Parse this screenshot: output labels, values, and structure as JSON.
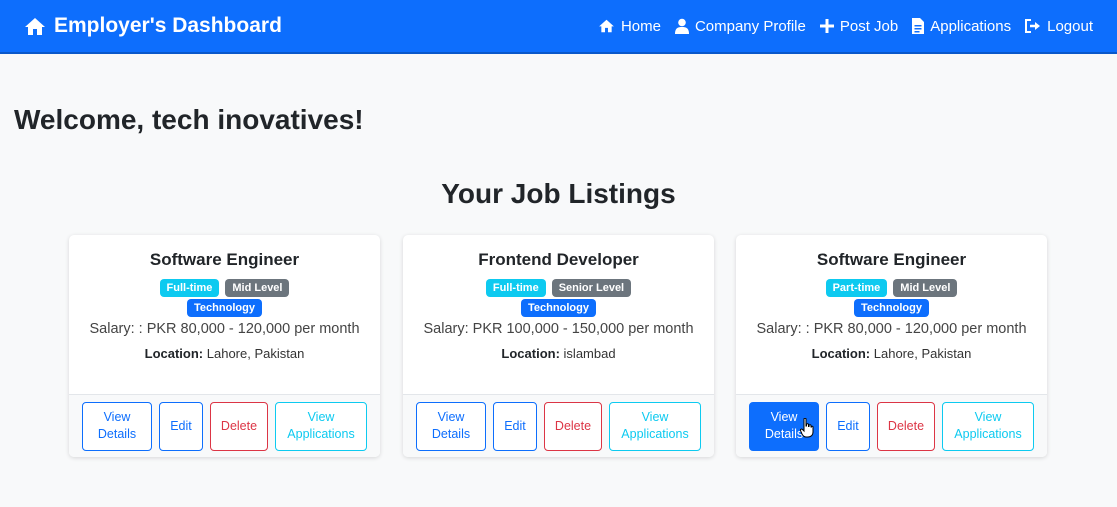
{
  "navbar": {
    "brand": "Employer's Dashboard",
    "links": [
      "Home",
      "Company Profile",
      "Post Job",
      "Applications",
      "Logout"
    ]
  },
  "welcome": "Welcome, tech inovatives!",
  "section_title": "Your Job Listings",
  "location_label": "Location:",
  "buttons": {
    "view_details_line1": "View",
    "view_details_line2": "Details",
    "edit": "Edit",
    "delete": "Delete",
    "view_apps_line1": "View",
    "view_apps_line2": "Applications"
  },
  "jobs": [
    {
      "title": "Software Engineer",
      "type": "Full-time",
      "level": "Mid Level",
      "category": "Technology",
      "salary": "Salary: : PKR 80,000 - 120,000 per month",
      "location": "Lahore, Pakistan"
    },
    {
      "title": "Frontend Developer",
      "type": "Full-time",
      "level": "Senior Level",
      "category": "Technology",
      "salary": "Salary: PKR 100,000 - 150,000 per month",
      "location": "islambad"
    },
    {
      "title": "Software Engineer",
      "type": "Part-time",
      "level": "Mid Level",
      "category": "Technology",
      "salary": "Salary: : PKR 80,000 - 120,000 per month",
      "location": "Lahore, Pakistan"
    }
  ],
  "colors": {
    "primary": "#0d6efd",
    "info": "#0dcaf0",
    "secondary": "#6c757d",
    "danger": "#dc3545"
  }
}
